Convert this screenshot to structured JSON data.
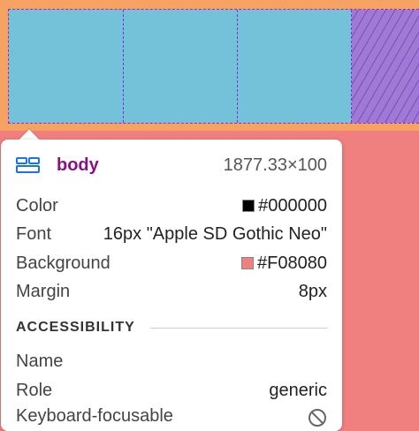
{
  "inspector": {
    "element_tag": "body",
    "dimensions": "1877.33×100",
    "color": {
      "label": "Color",
      "value": "#000000",
      "swatch": "#000000"
    },
    "font": {
      "label": "Font",
      "value": "16px \"Apple SD Gothic Neo\""
    },
    "background": {
      "label": "Background",
      "value": "#F08080",
      "swatch": "#F08080"
    },
    "margin": {
      "label": "Margin",
      "value": "8px"
    },
    "accessibility": {
      "title": "ACCESSIBILITY",
      "name_label": "Name",
      "name_value": "",
      "role_label": "Role",
      "role_value": "generic",
      "keyboard_label": "Keyboard-focusable",
      "keyboard_icon": "not-allowed-icon"
    }
  },
  "colors": {
    "page_background": "#F08080",
    "margin_highlight": "#F6A263",
    "content_highlight": "#73C2DA",
    "gap_highlight": "#9F79D3",
    "flex_outline": "#8A2BE2",
    "tag_color": "#881280"
  }
}
